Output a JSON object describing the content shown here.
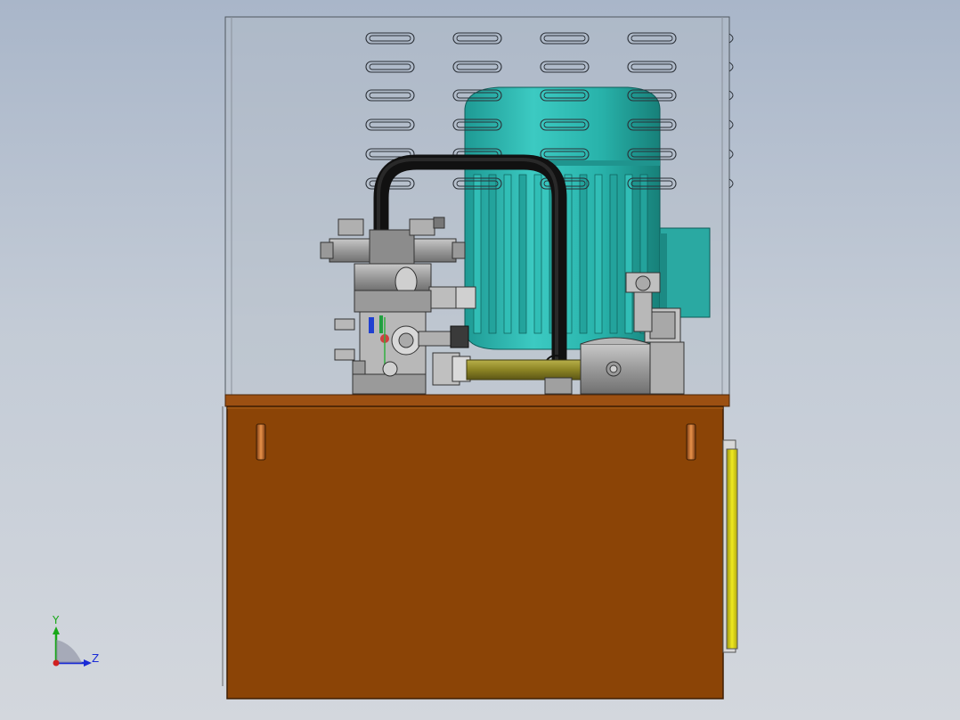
{
  "viewport": {
    "background_top": "#a9b6c9",
    "background_bottom": "#d3d7dd"
  },
  "colors": {
    "tank": "#8b4406",
    "tank_edge": "#4a2408",
    "tank_top": "#9c5012",
    "motor": "#2bb8b0",
    "motor_dark": "#1a8c86",
    "steel": "#a8a8a8",
    "steel_dark": "#6c6c6c",
    "hose": "#1a1a1a",
    "pipe": "#8c8424",
    "panel_yellow": "#e8e010",
    "handle": "#c8702a"
  },
  "triad": {
    "x_axis_label": "Z",
    "y_axis_label": "Y",
    "x_axis_color": "#1a2bd6",
    "y_axis_color": "#18a818",
    "z_axis_color": "#d02020"
  }
}
